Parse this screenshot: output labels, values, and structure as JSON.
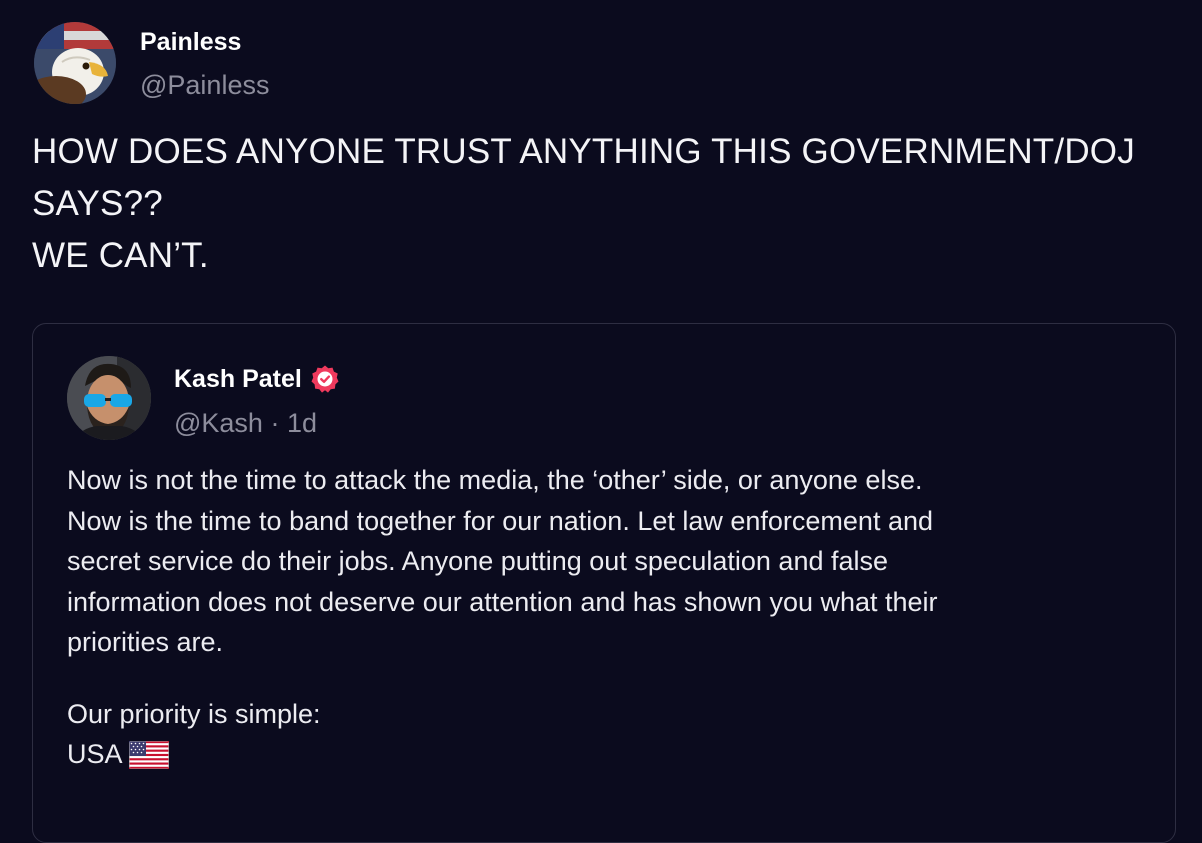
{
  "post": {
    "author": {
      "display_name": "Painless",
      "handle": "@Painless",
      "avatar_icon": "eagle-avatar"
    },
    "text_lines": [
      "HOW DOES ANYONE TRUST ANYTHING THIS GOVERNMENT/DOJ",
      "SAYS??",
      "WE CAN’T."
    ]
  },
  "quoted_post": {
    "author": {
      "display_name": "Kash Patel",
      "verified_icon": "verified-badge-icon",
      "verified_color": "#ef3a5d",
      "handle": "@Kash",
      "separator": "·",
      "timestamp": "1d",
      "avatar_icon": "person-avatar"
    },
    "body_lines": [
      "Now is not the time to attack the media, the ‘other’ side, or anyone else.",
      "Now is the time to band together for our nation. Let law enforcement and",
      "secret service do their jobs. Anyone putting out speculation and false",
      "information does not deserve our attention and has shown you what their",
      "priorities are."
    ],
    "closing_lines": [
      "Our priority is simple:",
      "USA"
    ],
    "flag_icon": "us-flag-icon"
  },
  "colors": {
    "background": "#0b0b1e",
    "text_primary": "#f4f4f7",
    "text_secondary": "#8d8d9c",
    "card_border": "#2e2e42"
  }
}
